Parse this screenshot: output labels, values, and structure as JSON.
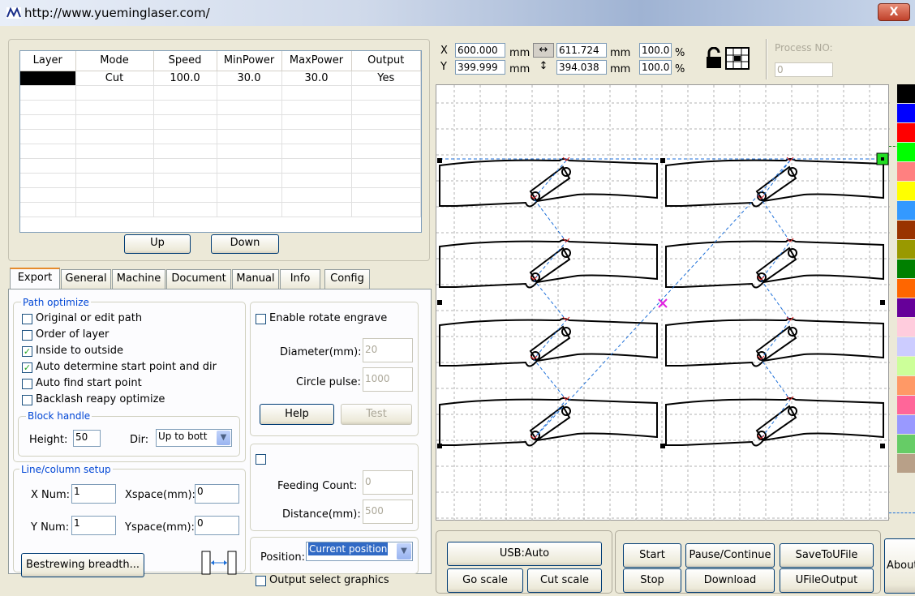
{
  "window": {
    "title": "http://www.yueminglaser.com/",
    "close": "X"
  },
  "layers": {
    "headers": [
      "Layer",
      "Mode",
      "Speed",
      "MinPower",
      "MaxPower",
      "Output"
    ],
    "rows": [
      {
        "mode": "Cut",
        "speed": "100.0",
        "min": "30.0",
        "max": "30.0",
        "output": "Yes",
        "color": "#000000"
      }
    ],
    "up": "Up",
    "down": "Down"
  },
  "tabs": [
    "Export",
    "General",
    "Machine",
    "Document",
    "Manual",
    "Info",
    "Config"
  ],
  "export": {
    "path_optimize": "Path optimize",
    "options": [
      {
        "label": "Original or edit path",
        "checked": false
      },
      {
        "label": "Order of layer",
        "checked": false
      },
      {
        "label": "Inside to outside",
        "checked": true
      },
      {
        "label": "Auto determine start point and dir",
        "checked": true
      },
      {
        "label": "Auto find start point",
        "checked": false
      },
      {
        "label": "Backlash reapy optimize",
        "checked": false
      }
    ],
    "block_handle": "Block handle",
    "height_label": "Height:",
    "height_value": "50",
    "dir_label": "Dir:",
    "dir_value": "Up to bott",
    "line_column": "Line/column setup",
    "xnum_label": "X Num:",
    "xnum": "1",
    "xspace_label": "Xspace(mm):",
    "xspace": "0",
    "ynum_label": "Y Num:",
    "ynum": "1",
    "yspace_label": "Yspace(mm):",
    "yspace": "0",
    "bestrewing": "Bestrewing breadth...",
    "rotate_label": "Enable rotate engrave",
    "diameter_label": "Diameter(mm):",
    "diameter": "20",
    "pulse_label": "Circle pulse:",
    "pulse": "1000",
    "help": "Help",
    "test": "Test",
    "feeding_label": "Feeding Count:",
    "feeding": "0",
    "distance_label": "Distance(mm):",
    "distance": "500",
    "position_label": "Position:",
    "position_value": "Current position",
    "output_select": "Output select graphics"
  },
  "coords": {
    "x_label": "X",
    "x": "600.000",
    "y_label": "Y",
    "y": "399.999",
    "unit": "mm",
    "w": "611.724",
    "h": "394.038",
    "sx": "100.0",
    "sy": "100.0",
    "pct": "%",
    "process_label": "Process NO:",
    "process": "0"
  },
  "controls": {
    "usb": "USB:Auto",
    "go_scale": "Go scale",
    "cut_scale": "Cut scale",
    "start": "Start",
    "pause": "Pause/Continue",
    "save_u": "SaveToUFile",
    "stop": "Stop",
    "download": "Download",
    "ufile_output": "UFileOutput",
    "about": "About"
  },
  "palette": [
    "#000000",
    "#0000ff",
    "#ff0000",
    "#00ff00",
    "#ff8080",
    "#ffff00",
    "#3399ff",
    "#993300",
    "#999900",
    "#008000",
    "#ff6600",
    "#660099",
    "#ffccdd",
    "#ccccff",
    "#ccff99",
    "#ff9966",
    "#ff6699",
    "#9999ff",
    "#66cc66",
    "#b8a088"
  ],
  "canvas": {
    "grid": true,
    "shapes_cols": 2,
    "shapes_rows": 4
  }
}
